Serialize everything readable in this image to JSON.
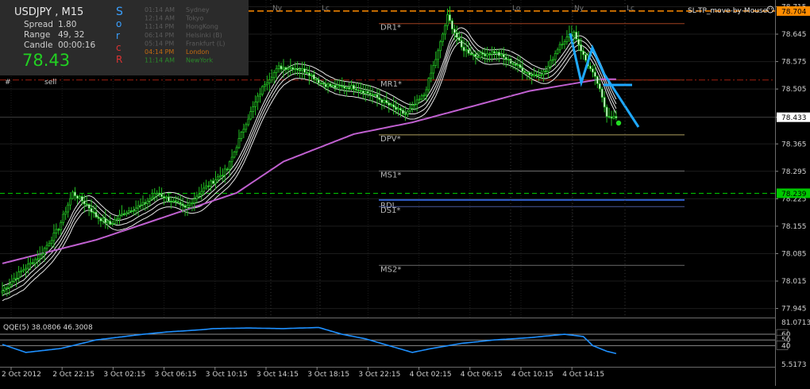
{
  "symbol_timeframe": "USDJPY , M15",
  "info_panel": {
    "spread_label": "Spread",
    "spread_value": "1.80",
    "range_label": "Range",
    "range_value": "49, 32",
    "candle_label": "Candle",
    "candle_value": "00:00:16",
    "price": "78.43",
    "vertical_letters": [
      "S",
      "o",
      "r",
      "c",
      "R"
    ]
  },
  "sessions": [
    {
      "time": "01:14 AM",
      "city": "Sydney",
      "color": "#5a5a5a"
    },
    {
      "time": "12:14 AM",
      "city": "Tokyo",
      "color": "#5a5a5a"
    },
    {
      "time": "11:14 PM",
      "city": "HongKong",
      "color": "#5a5a5a"
    },
    {
      "time": "06:14 PM",
      "city": "Helsinki (B)",
      "color": "#5a5a5a"
    },
    {
      "time": "05:14 PM",
      "city": "Frankfurt (L)",
      "color": "#5a5a5a"
    },
    {
      "time": "04:14 PM",
      "city": "London",
      "color": "#c06a10"
    },
    {
      "time": "11:14 AM",
      "city": "NewYork",
      "color": "#2a8a2a"
    }
  ],
  "indicator_label": "SL-TP_move-by-Mouse",
  "sell_label": "sell",
  "top_session_markers": [
    "Ny",
    "Lc",
    "Lo",
    "Ny",
    "Lc"
  ],
  "pivot_levels": {
    "DR1": {
      "label": "DR1*",
      "value": 78.672
    },
    "MR1": {
      "label": "MR1*",
      "value": 78.528
    },
    "DPV": {
      "label": "DPV*",
      "value": 78.388
    },
    "MS1": {
      "label": "MS1*",
      "value": 78.296
    },
    "RDL": {
      "label": "RDL",
      "value": 78.222
    },
    "DS1": {
      "label": "DS1*",
      "value": 78.205
    },
    "MS2": {
      "label": "MS2*",
      "value": 78.055
    }
  },
  "price_tags": [
    {
      "text": "78.704",
      "value": 78.704,
      "bg": "#ff8c00",
      "fg": "#000000"
    },
    {
      "text": "78.433",
      "value": 78.433,
      "bg": "#ffffff",
      "fg": "#000000"
    },
    {
      "text": "78.239",
      "value": 78.239,
      "bg": "#00c800",
      "fg": "#000000"
    }
  ],
  "qqe": {
    "label": "QQE(5) 38.0806 46.3008",
    "axis_labels": [
      "81.0713",
      "60",
      "50",
      "40",
      "5.5173"
    ],
    "levels": [
      60,
      50,
      40
    ]
  },
  "chart_data": {
    "type": "candlestick",
    "symbol": "USDJPY",
    "timeframe": "M15",
    "ylim": [
      77.93,
      78.72
    ],
    "y_ticks": [
      "78.715",
      "78.645",
      "78.575",
      "78.505",
      "78.433",
      "78.365",
      "78.295",
      "78.225",
      "78.155",
      "78.085",
      "78.015",
      "77.945"
    ],
    "x_ticks": [
      "2 Oct 2012",
      "2 Oct 22:15",
      "3 Oct 02:15",
      "3 Oct 06:15",
      "3 Oct 10:15",
      "3 Oct 14:15",
      "3 Oct 18:15",
      "3 Oct 22:15",
      "4 Oct 02:15",
      "4 Oct 06:15",
      "4 Oct 10:15",
      "4 Oct 14:15"
    ],
    "close_anchors": [
      [
        0,
        77.99
      ],
      [
        8,
        78.04
      ],
      [
        16,
        78.08
      ],
      [
        24,
        78.15
      ],
      [
        30,
        78.24
      ],
      [
        36,
        78.21
      ],
      [
        40,
        78.18
      ],
      [
        46,
        78.16
      ],
      [
        52,
        78.19
      ],
      [
        60,
        78.21
      ],
      [
        66,
        78.24
      ],
      [
        72,
        78.22
      ],
      [
        78,
        78.2
      ],
      [
        84,
        78.24
      ],
      [
        90,
        78.27
      ],
      [
        96,
        78.3
      ],
      [
        104,
        78.42
      ],
      [
        112,
        78.52
      ],
      [
        118,
        78.56
      ],
      [
        124,
        78.56
      ],
      [
        130,
        78.55
      ],
      [
        136,
        78.52
      ],
      [
        142,
        78.51
      ],
      [
        150,
        78.51
      ],
      [
        158,
        78.49
      ],
      [
        166,
        78.46
      ],
      [
        172,
        78.44
      ],
      [
        180,
        78.49
      ],
      [
        186,
        78.6
      ],
      [
        190,
        78.69
      ],
      [
        196,
        78.61
      ],
      [
        202,
        78.59
      ],
      [
        210,
        78.6
      ],
      [
        218,
        78.57
      ],
      [
        226,
        78.54
      ],
      [
        232,
        78.55
      ],
      [
        238,
        78.62
      ],
      [
        244,
        78.65
      ],
      [
        248,
        78.59
      ],
      [
        254,
        78.52
      ],
      [
        258,
        78.44
      ],
      [
        262,
        78.43
      ]
    ],
    "current_price": 78.433,
    "ma_purple": [
      [
        0,
        78.06
      ],
      [
        40,
        78.12
      ],
      [
        80,
        78.2
      ],
      [
        100,
        78.24
      ],
      [
        120,
        78.32
      ],
      [
        150,
        78.39
      ],
      [
        175,
        78.42
      ],
      [
        200,
        78.46
      ],
      [
        225,
        78.5
      ],
      [
        255,
        78.53
      ]
    ]
  }
}
